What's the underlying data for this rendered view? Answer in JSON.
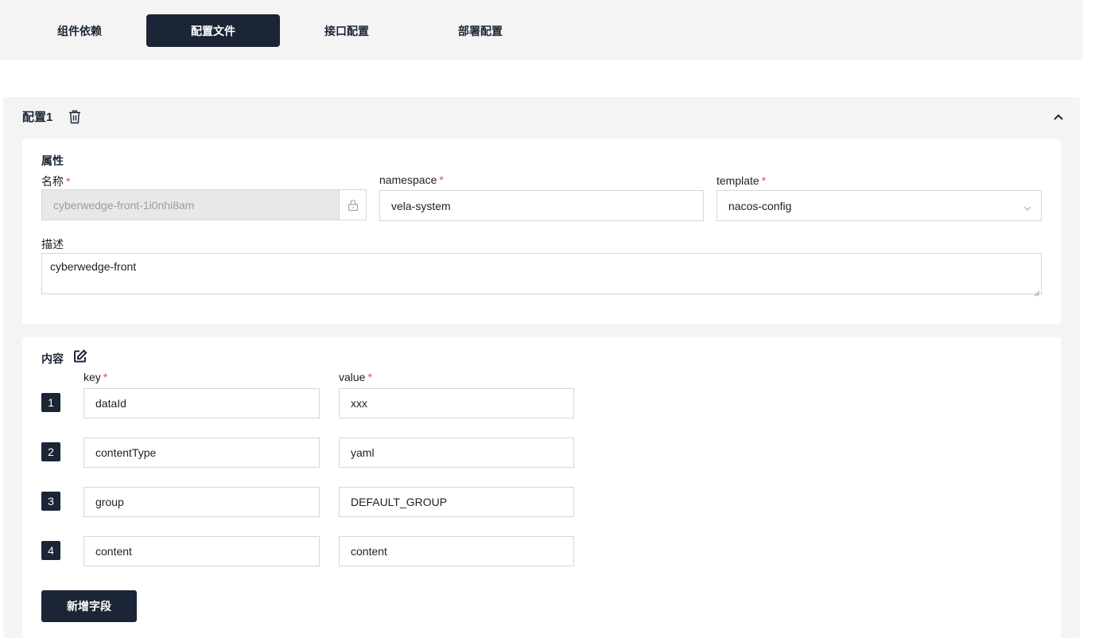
{
  "tabs": [
    {
      "label": "组件依赖"
    },
    {
      "label": "配置文件"
    },
    {
      "label": "接口配置"
    },
    {
      "label": "部署配置"
    }
  ],
  "active_tab": "配置文件",
  "config": {
    "title": "配置1",
    "attributes": {
      "section_title": "属性",
      "name_label": "名称",
      "name_value": "cyberwedge-front-1i0nhi8am",
      "namespace_label": "namespace",
      "namespace_value": "vela-system",
      "template_label": "template",
      "template_value": "nacos-config",
      "desc_label": "描述",
      "desc_value": "cyberwedge-front",
      "required_mark": "*"
    },
    "content": {
      "section_title": "内容",
      "key_label": "key",
      "value_label": "value",
      "rows": [
        {
          "index": "1",
          "key": "dataId",
          "value": "xxx"
        },
        {
          "index": "2",
          "key": "contentType",
          "value": "yaml"
        },
        {
          "index": "3",
          "key": "group",
          "value": "DEFAULT_GROUP"
        },
        {
          "index": "4",
          "key": "content",
          "value": "content"
        }
      ],
      "add_button": "新增字段"
    }
  },
  "colors": {
    "accent": "#1b2536",
    "required": "#e5484d",
    "panel_bg": "#f4f4f4"
  },
  "icons": {
    "delete": "trash-icon",
    "collapse": "chevron-up-icon",
    "lock": "lock-icon",
    "select": "chevron-down-icon",
    "edit": "edit-icon"
  }
}
